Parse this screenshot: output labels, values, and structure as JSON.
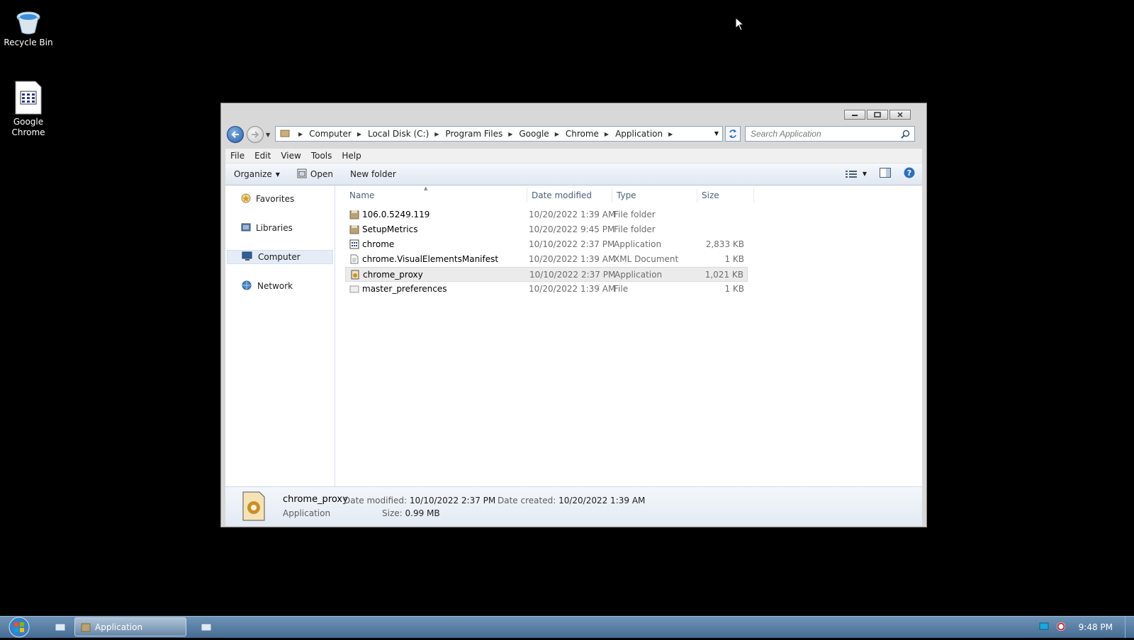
{
  "desktop": {
    "icons": [
      {
        "label": "Recycle Bin",
        "icon": "recycle-bin-icon"
      },
      {
        "label": "Google Chrome",
        "icon": "chrome-shortcut-icon"
      }
    ]
  },
  "window": {
    "nav": {
      "breadcrumb": [
        "Computer",
        "Local Disk (C:)",
        "Program Files",
        "Google",
        "Chrome",
        "Application"
      ]
    },
    "search": {
      "placeholder": "Search Application"
    },
    "menu": [
      "File",
      "Edit",
      "View",
      "Tools",
      "Help"
    ],
    "toolbar": {
      "organize": "Organize",
      "open": "Open",
      "new_folder": "New folder"
    },
    "sidebar": [
      {
        "label": "Favorites",
        "icon": "star-icon"
      },
      {
        "label": "Libraries",
        "icon": "library-icon"
      },
      {
        "label": "Computer",
        "icon": "computer-icon",
        "selected": true
      },
      {
        "label": "Network",
        "icon": "network-icon"
      }
    ],
    "columns": [
      "Name",
      "Date modified",
      "Type",
      "Size"
    ],
    "files": [
      {
        "name": "106.0.5249.119",
        "date": "10/20/2022 1:39 AM",
        "type": "File folder",
        "size": "",
        "icon": "folder-icon"
      },
      {
        "name": "SetupMetrics",
        "date": "10/20/2022 9:45 PM",
        "type": "File folder",
        "size": "",
        "icon": "folder-icon"
      },
      {
        "name": "chrome",
        "date": "10/10/2022 2:37 PM",
        "type": "Application",
        "size": "2,833 KB",
        "icon": "application-icon"
      },
      {
        "name": "chrome.VisualElementsManifest",
        "date": "10/20/2022 1:39 AM",
        "type": "XML Document",
        "size": "1 KB",
        "icon": "xml-icon"
      },
      {
        "name": "chrome_proxy",
        "date": "10/10/2022 2:37 PM",
        "type": "Application",
        "size": "1,021 KB",
        "icon": "application-icon",
        "selected": true
      },
      {
        "name": "master_preferences",
        "date": "10/20/2022 1:39 AM",
        "type": "File",
        "size": "1 KB",
        "icon": "file-icon"
      }
    ],
    "details": {
      "name": "chrome_proxy",
      "type": "Application",
      "modified_label": "Date modified:",
      "modified": "10/10/2022 2:37 PM",
      "created_label": "Date created:",
      "created": "10/20/2022 1:39 AM",
      "size_label": "Size:",
      "size": "0.99 MB"
    }
  },
  "taskbar": {
    "app_label": "Application",
    "clock": "9:48 PM"
  }
}
